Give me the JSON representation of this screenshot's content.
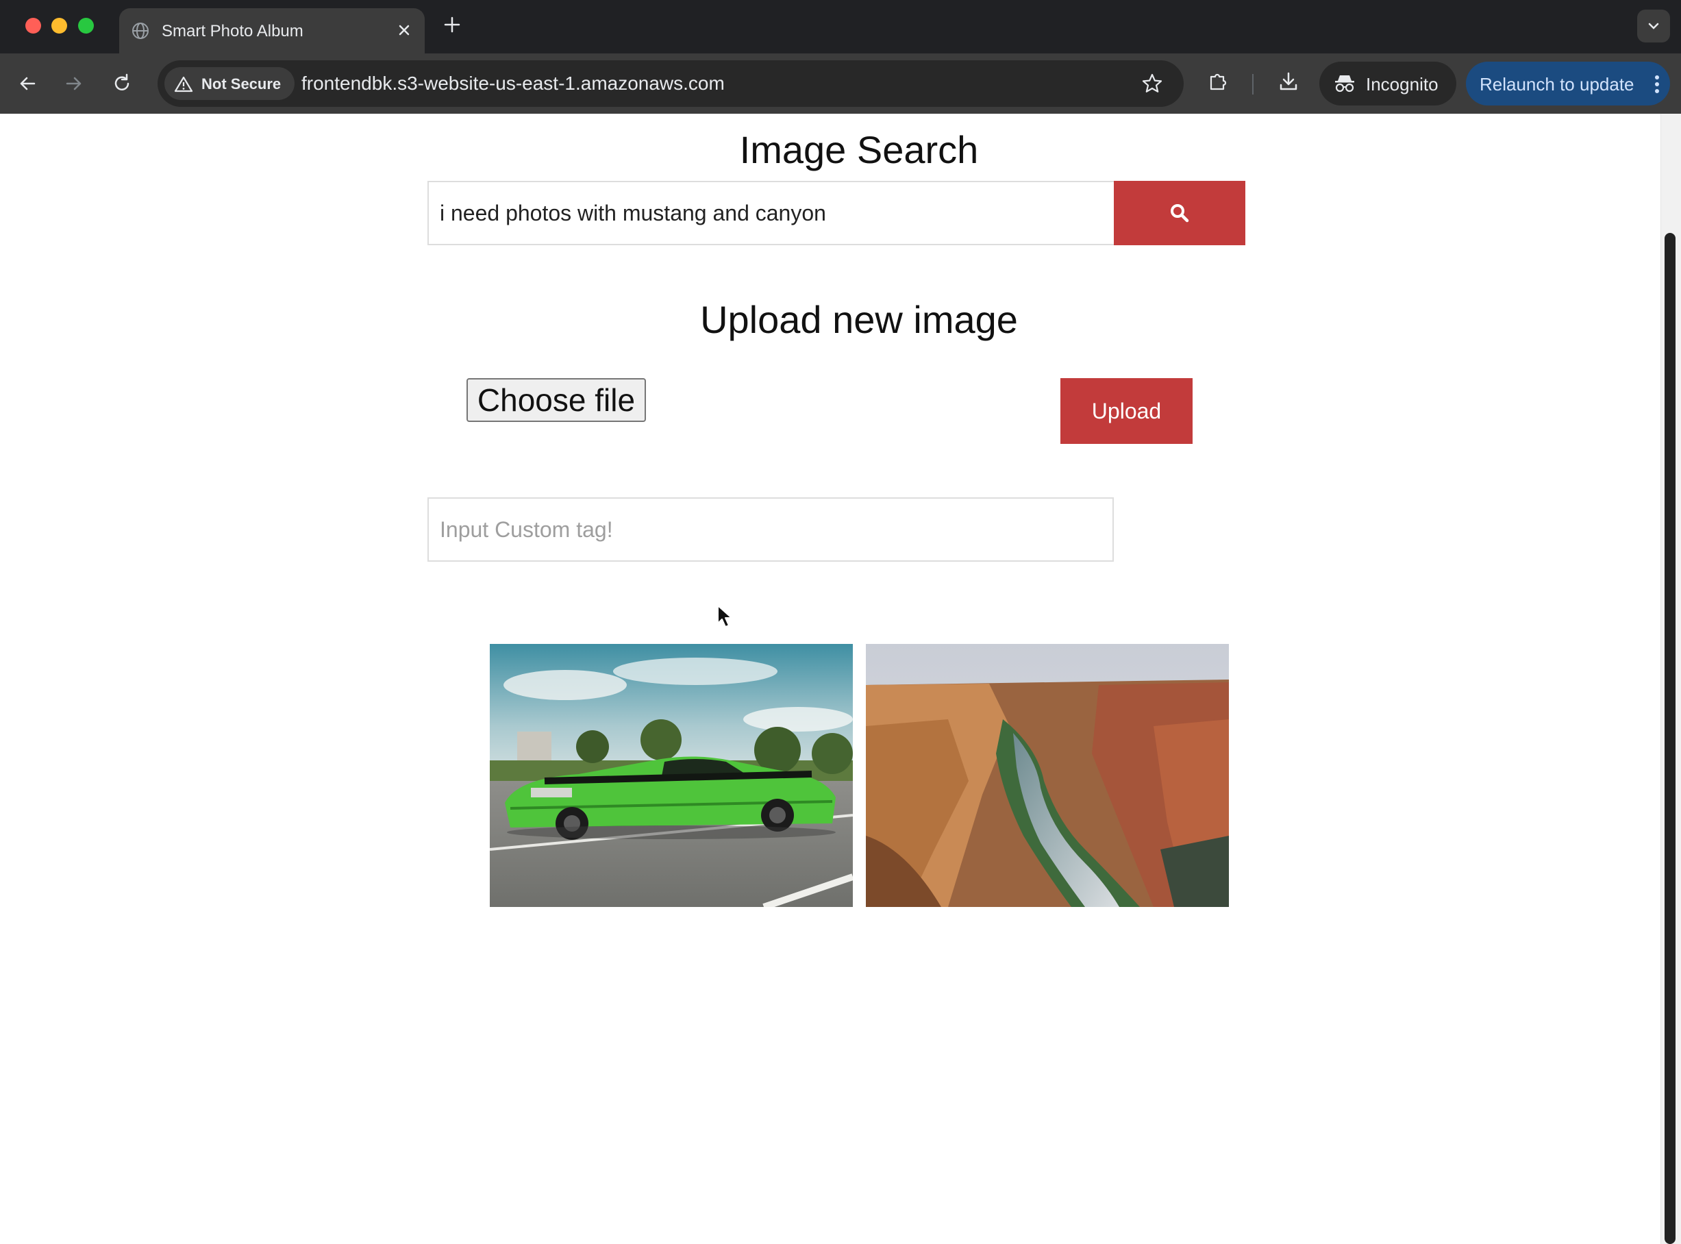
{
  "browser": {
    "tab_title": "Smart Photo Album",
    "security_label": "Not Secure",
    "url": "frontendbk.s3-website-us-east-1.amazonaws.com",
    "incognito_label": "Incognito",
    "relaunch_label": "Relaunch to update",
    "icons": [
      "globe-icon",
      "close-icon",
      "plus-icon",
      "chevron-down-icon",
      "back-arrow-icon",
      "forward-arrow-icon",
      "reload-icon",
      "warning-icon",
      "star-icon",
      "extensions-icon",
      "download-icon",
      "incognito-icon",
      "more-vert-icon"
    ]
  },
  "search": {
    "heading": "Image Search",
    "query": "i need photos with mustang and canyon",
    "button_icon": "search-icon"
  },
  "upload": {
    "heading": "Upload new image",
    "choose_file_label": "Choose file",
    "upload_label": "Upload",
    "tag_placeholder": "Input Custom tag!"
  },
  "results": {
    "images": [
      {
        "subject": "green mustang car"
      },
      {
        "subject": "canyon river"
      }
    ]
  },
  "colors": {
    "accent_red": "#c23b3b",
    "chrome_dark": "#202124",
    "toolbar": "#3c3c3c",
    "relaunch_blue": "#1b4b80"
  }
}
